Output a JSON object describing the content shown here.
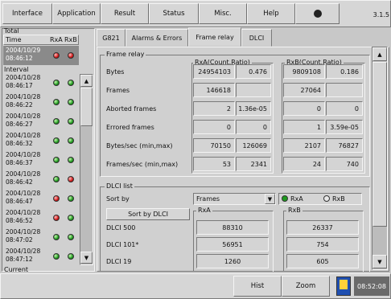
{
  "menu": {
    "items": [
      "Interface",
      "Application",
      "Result",
      "Status",
      "Misc.",
      "Help"
    ],
    "version": "3.1.5"
  },
  "left": {
    "total_label": "Total",
    "col_time": "Time",
    "col_rxa": "RxA",
    "col_rxb": "RxB",
    "total_row": {
      "date": "2004/10/29",
      "time": "08:46:12",
      "rxa": "red",
      "rxb": "red"
    },
    "interval_label": "Interval",
    "intervals": [
      {
        "date": "2004/10/28",
        "time": "08:46:17",
        "rxa": "green",
        "rxb": "green"
      },
      {
        "date": "2004/10/28",
        "time": "08:46:22",
        "rxa": "green",
        "rxb": "green"
      },
      {
        "date": "2004/10/28",
        "time": "08:46:27",
        "rxa": "green",
        "rxb": "green"
      },
      {
        "date": "2004/10/28",
        "time": "08:46:32",
        "rxa": "green",
        "rxb": "green"
      },
      {
        "date": "2004/10/28",
        "time": "08:46:37",
        "rxa": "green",
        "rxb": "green"
      },
      {
        "date": "2004/10/28",
        "time": "08:46:42",
        "rxa": "green",
        "rxb": "red"
      },
      {
        "date": "2004/10/28",
        "time": "08:46:47",
        "rxa": "red",
        "rxb": "green"
      },
      {
        "date": "2004/10/28",
        "time": "08:46:52",
        "rxa": "red",
        "rxb": "green"
      },
      {
        "date": "2004/10/28",
        "time": "08:47:02",
        "rxa": "green",
        "rxb": "green"
      },
      {
        "date": "2004/10/28",
        "time": "08:47:12",
        "rxa": "green",
        "rxb": "green"
      }
    ],
    "current_label": "Current"
  },
  "tabs": [
    "G821",
    "Alarms & Errors",
    "Frame relay",
    "DLCI"
  ],
  "frame_relay": {
    "title": "Frame relay",
    "rxa_header": "RxA(Count,Ratio)",
    "rxb_header": "RxB(Count,Ratio)",
    "rows": [
      {
        "label": "Bytes",
        "rxa_count": "24954103",
        "rxa_ratio": "0.476",
        "rxb_count": "9809108",
        "rxb_ratio": "0.186"
      },
      {
        "label": "Frames",
        "rxa_count": "146618",
        "rxa_ratio": "",
        "rxb_count": "27064",
        "rxb_ratio": ""
      },
      {
        "label": "Aborted frames",
        "rxa_count": "2",
        "rxa_ratio": "1.36e-05",
        "rxb_count": "0",
        "rxb_ratio": "0"
      },
      {
        "label": "Errored frames",
        "rxa_count": "0",
        "rxa_ratio": "0",
        "rxb_count": "1",
        "rxb_ratio": "3.59e-05"
      },
      {
        "label": "Bytes/sec (min,max)",
        "rxa_count": "70150",
        "rxa_ratio": "126069",
        "rxb_count": "2107",
        "rxb_ratio": "76827"
      },
      {
        "label": "Frames/sec (min,max)",
        "rxa_count": "53",
        "rxa_ratio": "2341",
        "rxb_count": "24",
        "rxb_ratio": "740"
      }
    ]
  },
  "dlci": {
    "title": "DLCI list",
    "sort_label": "Sort by",
    "sort_value": "Frames",
    "radio_rxa": "RxA",
    "radio_rxb": "RxB",
    "sort_button": "Sort by DLCI",
    "rxa_header": "RxA",
    "rxb_header": "RxB",
    "rows": [
      {
        "label": "DLCI 500",
        "rxa": "88310",
        "rxb": "26337"
      },
      {
        "label": "DLCI 101*",
        "rxa": "56951",
        "rxb": "754"
      },
      {
        "label": "DLCI 19",
        "rxa": "1260",
        "rxb": "605"
      }
    ]
  },
  "bottom": {
    "hist": "Hist",
    "zoom": "Zoom",
    "clock": "08:52:08"
  },
  "colors": {
    "led_green": "#1e9a1e",
    "led_red": "#d01515",
    "clock_bg": "#6a6a6a"
  }
}
